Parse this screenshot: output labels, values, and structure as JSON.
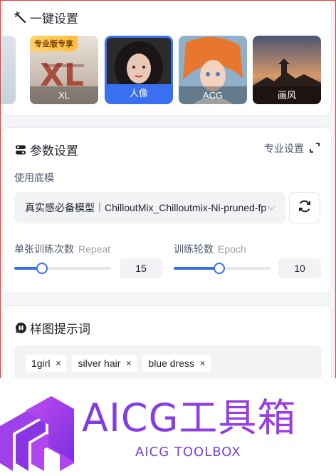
{
  "quick_setup": {
    "title": "一键设置",
    "presets": [
      {
        "label": "",
        "selected": false
      },
      {
        "label": "XL",
        "badge": "专业版专享",
        "selected": false
      },
      {
        "label": "人像",
        "selected": true
      },
      {
        "label": "ACG",
        "selected": false
      },
      {
        "label": "画风",
        "selected": false
      }
    ]
  },
  "params": {
    "title": "参数设置",
    "pro_link": "专业设置",
    "base_model_label": "使用底模",
    "base_model_value": "真实感必备模型｜ChilloutMix_Chilloutmix-Ni-pruned-fp",
    "repeat": {
      "label": "单张训练次数",
      "sub": "Repeat",
      "value": "15",
      "fraction": 0.29
    },
    "epoch": {
      "label": "训练轮数",
      "sub": "Epoch",
      "value": "10",
      "fraction": 0.47
    }
  },
  "prompt": {
    "title": "样图提示词",
    "tags": [
      "1girl",
      "silver hair",
      "blue dress"
    ]
  },
  "brand": {
    "title": "AICG工具箱",
    "subtitle": "AICG TOOLBOX"
  },
  "colors": {
    "accent": "#3a6ff0",
    "brand": "#7b3fe4",
    "badge": "#ffc44a"
  }
}
